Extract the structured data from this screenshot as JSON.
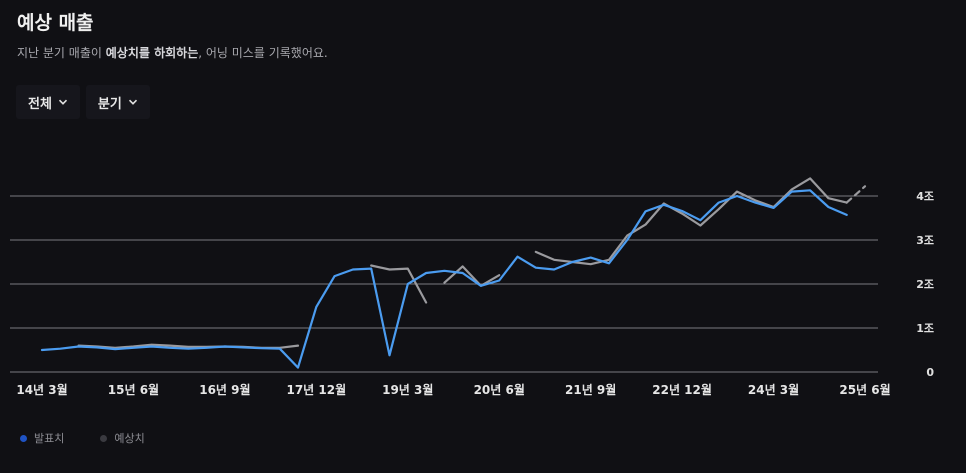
{
  "header": {
    "title": "예상 매출",
    "subtitle_pre": "지난 분기 매출이 ",
    "subtitle_bold": "예상치를 하회하는",
    "subtitle_post": ", 어닝 미스를 기록했어요."
  },
  "filters": {
    "range_label": "전체",
    "period_label": "분기"
  },
  "legend": {
    "actual_label": "발표치",
    "estimate_label": "예상치"
  },
  "colors": {
    "actual": "#4b9cf0",
    "actual_legend": "#1f53c4",
    "estimate": "#9a9a9e",
    "estimate_legend": "#3a3a40",
    "grid": "#7a7a80"
  },
  "chart_data": {
    "type": "line",
    "y_unit": "조",
    "ylim": [
      0,
      4.2
    ],
    "y_ticks": [
      {
        "value": 0,
        "label": "0"
      },
      {
        "value": 1,
        "label": "1조"
      },
      {
        "value": 2,
        "label": "2조"
      },
      {
        "value": 3,
        "label": "3조"
      },
      {
        "value": 4,
        "label": "4조"
      }
    ],
    "x_range": [
      0,
      45
    ],
    "x_ticks": [
      {
        "x": 0,
        "label": "14년 3월"
      },
      {
        "x": 5,
        "label": "15년 6월"
      },
      {
        "x": 10,
        "label": "16년 9월"
      },
      {
        "x": 15,
        "label": "17년 12월"
      },
      {
        "x": 20,
        "label": "19년 3월"
      },
      {
        "x": 25,
        "label": "20년 6월"
      },
      {
        "x": 30,
        "label": "21년 9월"
      },
      {
        "x": 35,
        "label": "22년 12월"
      },
      {
        "x": 40,
        "label": "24년 3월"
      },
      {
        "x": 45,
        "label": "25년 6월"
      }
    ],
    "grid": true,
    "legend_position": "bottom-left",
    "series": [
      {
        "name": "발표치",
        "segments": [
          [
            [
              0,
              0.5
            ],
            [
              1,
              0.53
            ],
            [
              2,
              0.58
            ],
            [
              3,
              0.56
            ],
            [
              4,
              0.52
            ],
            [
              5,
              0.55
            ],
            [
              6,
              0.58
            ],
            [
              7,
              0.55
            ],
            [
              8,
              0.53
            ],
            [
              9,
              0.55
            ],
            [
              10,
              0.58
            ],
            [
              11,
              0.56
            ],
            [
              12,
              0.54
            ],
            [
              13,
              0.53
            ],
            [
              14,
              0.1
            ],
            [
              15,
              1.48
            ],
            [
              16,
              2.18
            ],
            [
              17,
              2.33
            ],
            [
              18,
              2.35
            ],
            [
              19,
              0.38
            ],
            [
              20,
              2.0
            ],
            [
              21,
              2.25
            ],
            [
              22,
              2.3
            ],
            [
              23,
              2.25
            ],
            [
              24,
              1.96
            ],
            [
              25,
              2.08
            ],
            [
              26,
              2.62
            ],
            [
              27,
              2.37
            ],
            [
              28,
              2.33
            ],
            [
              29,
              2.5
            ],
            [
              30,
              2.6
            ],
            [
              31,
              2.47
            ],
            [
              32,
              3.0
            ],
            [
              33,
              3.65
            ],
            [
              34,
              3.8
            ],
            [
              35,
              3.66
            ],
            [
              36,
              3.45
            ],
            [
              37,
              3.85
            ],
            [
              38,
              4.0
            ],
            [
              39,
              3.85
            ],
            [
              40,
              3.73
            ],
            [
              41,
              4.1
            ],
            [
              42,
              4.13
            ],
            [
              43,
              3.75
            ],
            [
              44,
              3.57
            ]
          ]
        ]
      },
      {
        "name": "예상치",
        "dashed_tail": true,
        "segments": [
          [
            [
              2,
              0.6
            ],
            [
              3,
              0.58
            ],
            [
              4,
              0.55
            ],
            [
              5,
              0.58
            ],
            [
              6,
              0.62
            ],
            [
              7,
              0.6
            ],
            [
              8,
              0.57
            ],
            [
              9,
              0.57
            ],
            [
              10,
              0.58
            ],
            [
              11,
              0.57
            ],
            [
              12,
              0.55
            ],
            [
              13,
              0.55
            ],
            [
              14,
              0.6
            ]
          ],
          [
            [
              18,
              2.42
            ],
            [
              19,
              2.33
            ],
            [
              20,
              2.35
            ],
            [
              21,
              1.58
            ]
          ],
          [
            [
              22,
              2.03
            ],
            [
              23,
              2.4
            ],
            [
              24,
              1.96
            ],
            [
              25,
              2.2
            ]
          ],
          [
            [
              27,
              2.73
            ],
            [
              28,
              2.55
            ],
            [
              29,
              2.5
            ],
            [
              30,
              2.45
            ],
            [
              31,
              2.55
            ],
            [
              32,
              3.1
            ],
            [
              33,
              3.35
            ],
            [
              34,
              3.83
            ],
            [
              35,
              3.6
            ],
            [
              36,
              3.33
            ],
            [
              37,
              3.7
            ],
            [
              38,
              4.1
            ],
            [
              39,
              3.9
            ],
            [
              40,
              3.75
            ],
            [
              41,
              4.15
            ],
            [
              42,
              4.4
            ],
            [
              43,
              3.95
            ],
            [
              44,
              3.85
            ],
            [
              45,
              4.22
            ]
          ]
        ]
      }
    ]
  }
}
